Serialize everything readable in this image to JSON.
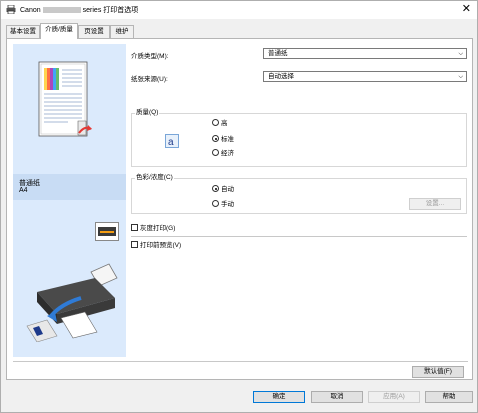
{
  "window": {
    "title_prefix": "Canon",
    "title_suffix": "series 打印首选项",
    "close_glyph": "✕"
  },
  "tabs": [
    {
      "label": "基本设置",
      "active": false
    },
    {
      "label": "介质/质量",
      "active": true
    },
    {
      "label": "页设置",
      "active": false
    },
    {
      "label": "维护",
      "active": false
    }
  ],
  "preview": {
    "media_name": "普通纸",
    "paper_size": "A4"
  },
  "media_type": {
    "label": "介质类型(M):",
    "value": "普通纸"
  },
  "paper_source": {
    "label": "纸张来源(U):",
    "value": "自动选择"
  },
  "quality": {
    "title": "质量(Q)",
    "options": [
      "高",
      "标准",
      "经济"
    ],
    "selected": "标准"
  },
  "color": {
    "title": "色彩/浓度(C)",
    "options": [
      "自动",
      "手动"
    ],
    "selected": "自动",
    "settings_button": "设置..."
  },
  "grayscale": {
    "label": "灰度打印(G)",
    "checked": false
  },
  "preview_before_print": {
    "label": "打印前预览(V)",
    "checked": false
  },
  "defaults_button": "默认值(F)",
  "footer": {
    "ok": "确定",
    "cancel": "取消",
    "apply": "应用(A)",
    "help": "帮助"
  },
  "icons": {
    "app": "printer-app-icon",
    "quality": "quality-letter-a-icon",
    "printer_thumb": "printer-thumbnail-icon",
    "printer_illustration": "printer-paper-feed-illustration"
  },
  "colors": {
    "preview_pane_bg": "#dbeafc",
    "preview_caption_bg": "#c8dcf4",
    "focus_border": "#0078d7"
  }
}
